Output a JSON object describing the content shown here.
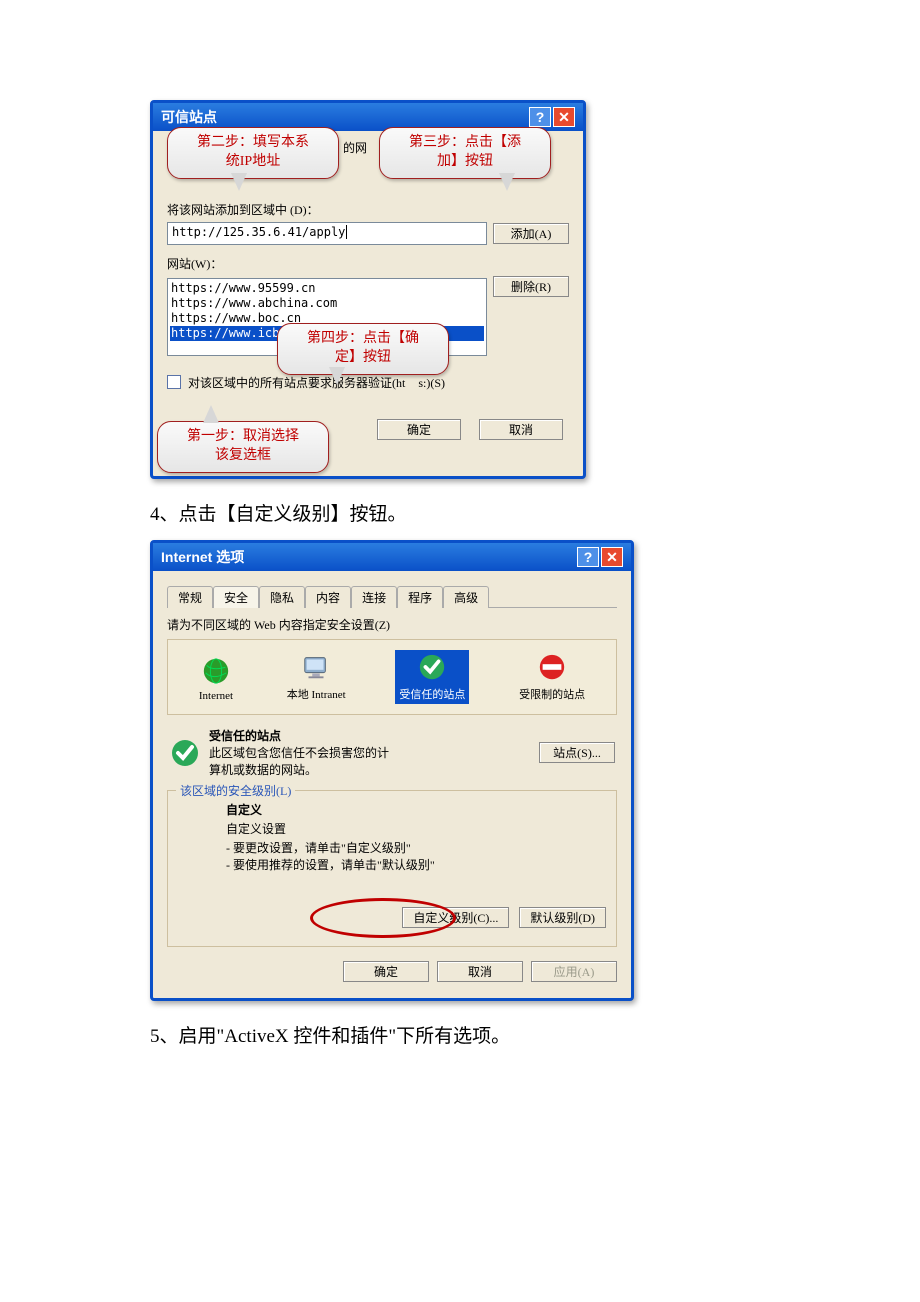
{
  "doc": {
    "step4": "4、点击【自定义级别】按钮。",
    "step5": "5、启用\"ActiveX 控件和插件\"下所有选项。"
  },
  "d1": {
    "title": "可信站点",
    "partial": "的网",
    "addZoneLabel": "将该网站添加到区域中 (D)：",
    "url": "http://125.35.6.41/apply",
    "addBtn": "添加(A)",
    "sitesLabel": "网站(W)：",
    "site1": "https://www.95599.cn",
    "site2": "https://www.abchina.com",
    "site3": "https://www.boc.cn",
    "site4": "https://www.icbc.com.cn",
    "delBtn": "删除(R)",
    "verify": "对该区域中的所有站点要求服务器验证(ht",
    "verify2": "s:)(S)",
    "ok": "确定",
    "cancel": "取消",
    "c1a": "第二步：填写本系",
    "c1b": "统IP地址",
    "c2a": "第三步：点击【添",
    "c2b": "加】按钮",
    "c3a": "第四步：点击【确",
    "c3b": "定】按钮",
    "c4a": "第一步：取消选择",
    "c4b": "该复选框"
  },
  "d2": {
    "title": "Internet 选项",
    "tab1": "常规",
    "tab2": "安全",
    "tab3": "隐私",
    "tab4": "内容",
    "tab5": "连接",
    "tab6": "程序",
    "tab7": "高级",
    "zonesHint": "请为不同区域的 Web 内容指定安全设置(Z)",
    "z1": "Internet",
    "z2": "本地 Intranet",
    "z3": "受信任的站点",
    "z4": "受限制的站点",
    "trustedHead": "受信任的站点",
    "trustedDesc1": "此区域包含您信任不会损害您的计",
    "trustedDesc2": "算机或数据的网站。",
    "sitesBtn": "站点(S)...",
    "legend": "该区域的安全级别(L)",
    "customHead": "自定义",
    "customSub": "自定义设置",
    "customL1": "- 要更改设置，请单击\"自定义级别\"",
    "customL2": "- 要使用推荐的设置，请单击\"默认级别\"",
    "customBtn": "自定义级别(C)...",
    "defaultBtn": "默认级别(D)",
    "ok": "确定",
    "cancel": "取消",
    "apply": "应用(A)"
  }
}
